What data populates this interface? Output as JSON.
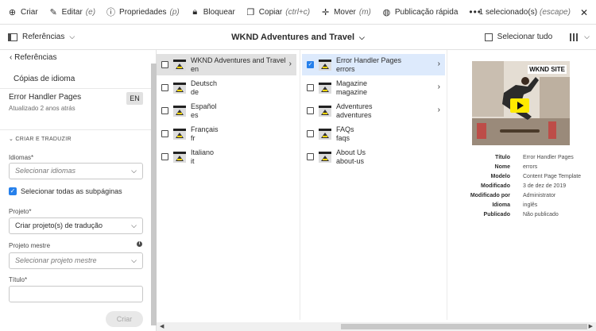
{
  "toolbar": {
    "items": [
      {
        "label": "Criar",
        "shortcut": "",
        "icon": "plus-circle-icon"
      },
      {
        "label": "Editar",
        "shortcut": "(e)",
        "icon": "pencil-icon"
      },
      {
        "label": "Propriedades",
        "shortcut": "(p)",
        "icon": "info-icon"
      },
      {
        "label": "Bloquear",
        "shortcut": "",
        "icon": "lock-icon"
      },
      {
        "label": "Copiar",
        "shortcut": "(ctrl+c)",
        "icon": "copy-icon"
      },
      {
        "label": "Mover",
        "shortcut": "(m)",
        "icon": "move-icon"
      },
      {
        "label": "Publicação rápida",
        "shortcut": "",
        "icon": "globe-icon"
      }
    ],
    "more": "•••",
    "selection": "1 selecionado(s)",
    "escape": "(escape)"
  },
  "subbar": {
    "rail_label": "Referências",
    "title": "WKND Adventures and Travel",
    "select_all": "Selecionar tudo"
  },
  "sidebar": {
    "back": "Referências",
    "language_copies": "Cópias de idioma",
    "page_title": "Error Handler Pages",
    "updated": "Atualizado 2 anos atrás",
    "lang_badge": "EN",
    "section": "CRIAR E TRADUZIR",
    "languages_label": "Idiomas*",
    "languages_placeholder": "Selecionar idiomas",
    "subpages_label": "Selecionar todas as subpáginas",
    "project_label": "Projeto*",
    "project_value": "Criar projeto(s) de tradução",
    "master_label": "Projeto mestre",
    "master_placeholder": "Selecionar projeto mestre",
    "title_label": "Título*",
    "create_button": "Criar"
  },
  "column1": [
    {
      "title": "WKND Adventures and Travel",
      "name": "en"
    },
    {
      "title": "Deutsch",
      "name": "de"
    },
    {
      "title": "Español",
      "name": "es"
    },
    {
      "title": "Français",
      "name": "fr"
    },
    {
      "title": "Italiano",
      "name": "it"
    }
  ],
  "column2": [
    {
      "title": "Error Handler Pages",
      "name": "errors"
    },
    {
      "title": "Magazine",
      "name": "magazine"
    },
    {
      "title": "Adventures",
      "name": "adventures"
    },
    {
      "title": "FAQs",
      "name": "faqs"
    },
    {
      "title": "About Us",
      "name": "about-us"
    }
  ],
  "preview": {
    "logo": "WKND SITE"
  },
  "metadata": [
    {
      "k": "Título",
      "v": "Error Handler Pages"
    },
    {
      "k": "Nome",
      "v": "errors"
    },
    {
      "k": "Modelo",
      "v": "Content Page Template"
    },
    {
      "k": "Modificado",
      "v": "3 de dez de 2019"
    },
    {
      "k": "Modificado por",
      "v": "Administrator"
    },
    {
      "k": "Idioma",
      "v": "inglês"
    },
    {
      "k": "Publicado",
      "v": "Não publicado"
    }
  ]
}
